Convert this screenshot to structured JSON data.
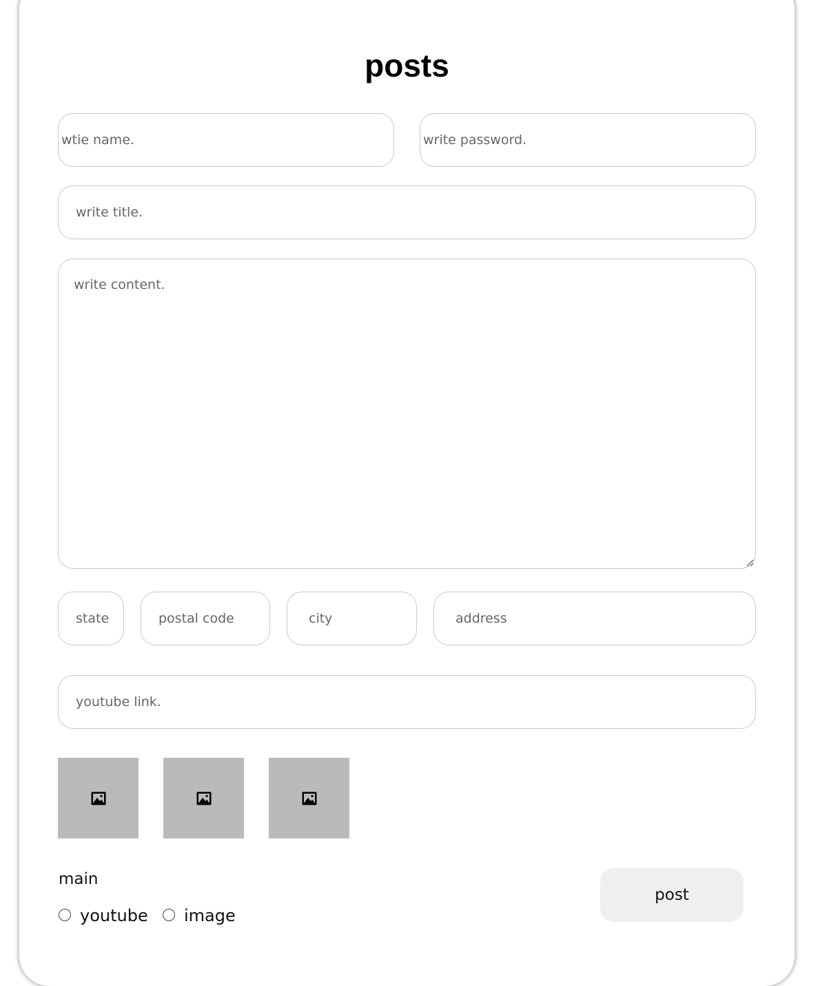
{
  "form": {
    "title": "posts",
    "name_placeholder": "wtie name.",
    "password_placeholder": "write password.",
    "title_placeholder": "write title.",
    "content_placeholder": "write content.",
    "state_placeholder": "state",
    "postal_placeholder": "postal code",
    "city_placeholder": "city",
    "address_placeholder": "address",
    "youtube_placeholder": "youtube link.",
    "image_slots": [
      {
        "icon": "image-icon"
      },
      {
        "icon": "image-icon"
      },
      {
        "icon": "image-icon"
      }
    ],
    "main_label": "main",
    "radio_youtube": "youtube",
    "radio_image": "image",
    "submit_label": "post"
  }
}
